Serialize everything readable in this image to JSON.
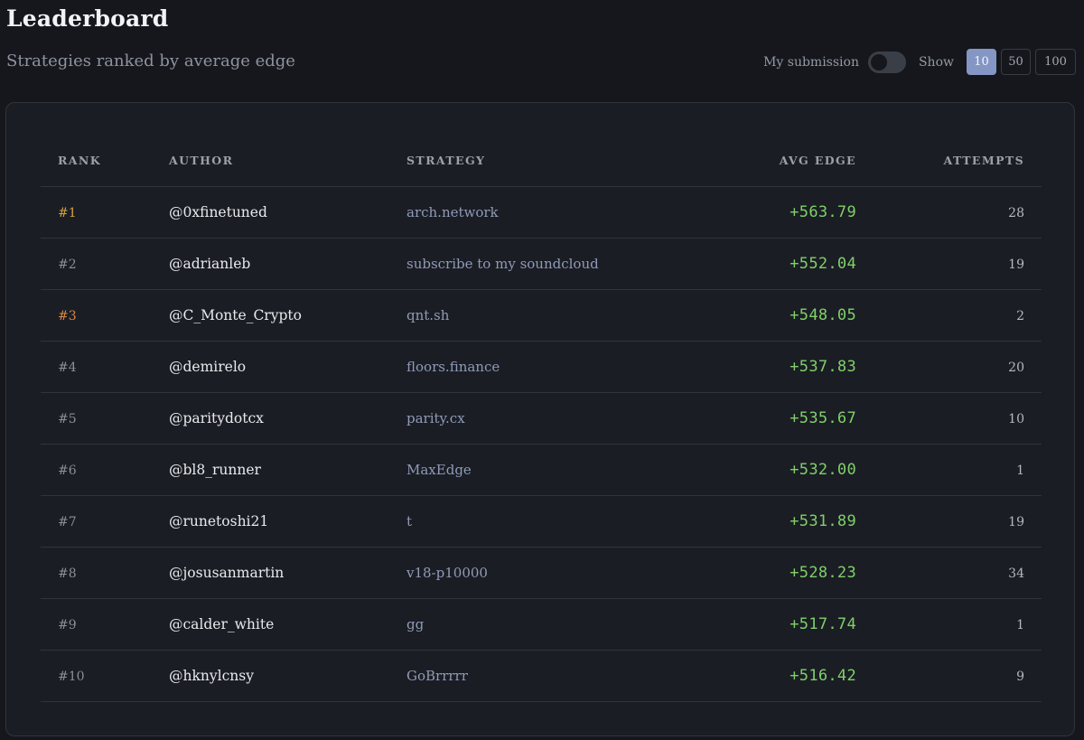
{
  "header": {
    "title": "Leaderboard",
    "subtitle": "Strategies ranked by average edge"
  },
  "controls": {
    "my_submission_label": "My submission",
    "my_submission_on": false,
    "show_label": "Show",
    "page_sizes": [
      "10",
      "50",
      "100"
    ],
    "selected_page_size": "10"
  },
  "colors": {
    "accent": "#8497c4",
    "positive": "#7fd06a",
    "gold": "#d2a13c",
    "bronze": "#d48a45"
  },
  "table": {
    "columns": [
      "RANK",
      "AUTHOR",
      "STRATEGY",
      "AVG EDGE",
      "ATTEMPTS"
    ],
    "rows": [
      {
        "rank": "#1",
        "author": "@0xfinetuned",
        "strategy": "arch.network",
        "avg_edge": "+563.79",
        "attempts": "28"
      },
      {
        "rank": "#2",
        "author": "@adrianleb",
        "strategy": "subscribe to my soundcloud",
        "avg_edge": "+552.04",
        "attempts": "19"
      },
      {
        "rank": "#3",
        "author": "@C_Monte_Crypto",
        "strategy": "qnt.sh",
        "avg_edge": "+548.05",
        "attempts": "2"
      },
      {
        "rank": "#4",
        "author": "@demirelo",
        "strategy": "floors.finance",
        "avg_edge": "+537.83",
        "attempts": "20"
      },
      {
        "rank": "#5",
        "author": "@paritydotcx",
        "strategy": "parity.cx",
        "avg_edge": "+535.67",
        "attempts": "10"
      },
      {
        "rank": "#6",
        "author": "@bl8_runner",
        "strategy": "MaxEdge",
        "avg_edge": "+532.00",
        "attempts": "1"
      },
      {
        "rank": "#7",
        "author": "@runetoshi21",
        "strategy": "t",
        "avg_edge": "+531.89",
        "attempts": "19"
      },
      {
        "rank": "#8",
        "author": "@josusanmartin",
        "strategy": "v18-p10000",
        "avg_edge": "+528.23",
        "attempts": "34"
      },
      {
        "rank": "#9",
        "author": "@calder_white",
        "strategy": "gg",
        "avg_edge": "+517.74",
        "attempts": "1"
      },
      {
        "rank": "#10",
        "author": "@hknylcnsy",
        "strategy": "GoBrrrrr",
        "avg_edge": "+516.42",
        "attempts": "9"
      }
    ]
  }
}
